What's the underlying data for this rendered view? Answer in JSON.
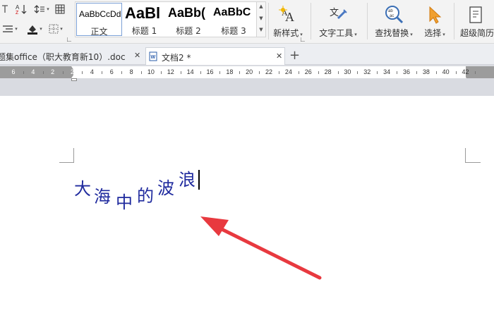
{
  "ribbon": {
    "styles": [
      {
        "sample": "AaBbCcDd",
        "name": "正文",
        "selected": true
      },
      {
        "sample": "AaBl",
        "name": "标题 1",
        "selected": false
      },
      {
        "sample": "AaBb(",
        "name": "标题 2",
        "selected": false
      },
      {
        "sample": "AaBbC",
        "name": "标题 3",
        "selected": false
      }
    ],
    "new_style_label": "新样式",
    "text_tools_label": "文字工具",
    "find_replace_label": "查找替换",
    "select_label": "选择",
    "super_label": "超级简历"
  },
  "tabs": [
    {
      "label": "题集office（职大教育新10）.doc",
      "active": false
    },
    {
      "label": "文档2 *",
      "active": true
    }
  ],
  "ruler": {
    "numbers": [
      "6",
      "4",
      "2",
      "2",
      "4",
      "6",
      "8",
      "10",
      "12",
      "14",
      "16",
      "18",
      "20",
      "22",
      "24",
      "26",
      "28",
      "30",
      "32",
      "34",
      "36",
      "38",
      "40",
      "42"
    ]
  },
  "document": {
    "chars": [
      "大",
      "海",
      "中",
      "的",
      "波",
      "浪"
    ],
    "text_color": "#1f2a9e"
  },
  "annotation": {
    "arrow_color": "#e8393f"
  }
}
